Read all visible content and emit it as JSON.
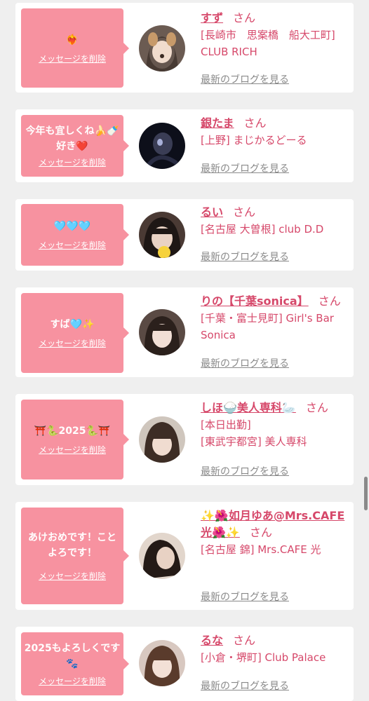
{
  "delete_label": "メッセージを削除",
  "blog_label": "最新のブログを見る",
  "san": "さん",
  "cards": [
    {
      "message": "❤️‍🔥",
      "name": "すず",
      "details": [
        "[長崎市　思案橋　船大工町] CLUB RICH"
      ]
    },
    {
      "message": "今年も宜しくね🍌🍼好き❤️",
      "name": "銀たま",
      "details": [
        "[上野] まじかるどーる"
      ]
    },
    {
      "message": "🩵🩵🩵",
      "name": "るい",
      "details": [
        "[名古屋 大曽根] club D.D"
      ]
    },
    {
      "message": "すば🩵✨",
      "name": "りの【千葉sonica】",
      "details": [
        "[千葉・富士見町] Girl's Bar Sonica"
      ]
    },
    {
      "message": "⛩️🐍2025🐍⛩️",
      "name": "しほ🍚美人専科🦢",
      "details": [
        "[本日出勤]",
        "[東武宇都宮] 美人専科"
      ]
    },
    {
      "message": "あけおめです！ことよろです！",
      "name": "✨🌺如月ゆあ@Mrs.CAFE光🌺✨",
      "details": [
        "[名古屋 錦] Mrs.CAFE 光"
      ]
    },
    {
      "message": "2025もよろしくです🐾",
      "name": "るな",
      "details": [
        "[小倉・堺町] Club Palace"
      ]
    }
  ],
  "colors": {
    "accent": "#f792a0",
    "name": "#d6486a",
    "link_gray": "#8a8a8a"
  }
}
